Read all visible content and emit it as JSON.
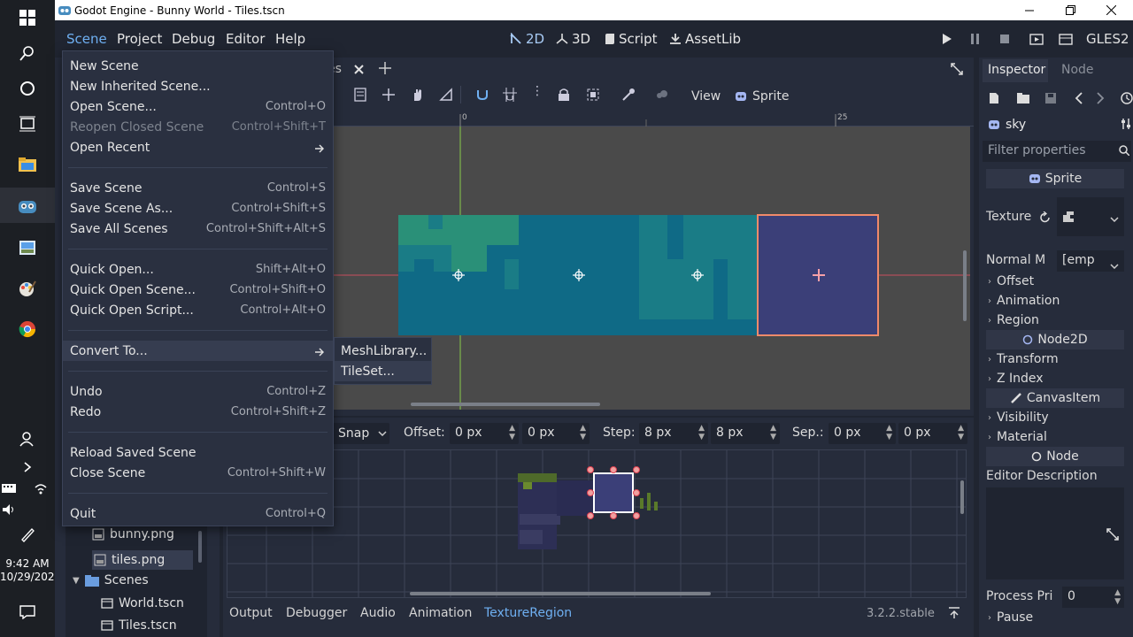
{
  "window": {
    "title": "Godot Engine - Bunny World - Tiles.tscn"
  },
  "taskbar": {
    "time": "9:42 AM",
    "date": "10/29/2020"
  },
  "menubar": {
    "menus": [
      "Scene",
      "Project",
      "Debug",
      "Editor",
      "Help"
    ],
    "workspaces": [
      "2D",
      "3D",
      "Script",
      "AssetLib"
    ],
    "renderer": "GLES2"
  },
  "scene_tab": {
    "label": "es"
  },
  "viewport_toolbar": {
    "view": "View",
    "node_type": "Sprite"
  },
  "ruler": {
    "zero": "0",
    "mark": "25"
  },
  "scene_menu": {
    "items": [
      {
        "label": "New Scene",
        "shortcut": ""
      },
      {
        "label": "New Inherited Scene...",
        "shortcut": ""
      },
      {
        "label": "Open Scene...",
        "shortcut": "Control+O"
      },
      {
        "label": "Reopen Closed Scene",
        "shortcut": "Control+Shift+T"
      },
      {
        "label": "Open Recent",
        "shortcut": ""
      },
      {
        "label": "Save Scene",
        "shortcut": "Control+S"
      },
      {
        "label": "Save Scene As...",
        "shortcut": "Control+Shift+S"
      },
      {
        "label": "Save All Scenes",
        "shortcut": "Control+Shift+Alt+S"
      },
      {
        "label": "Quick Open...",
        "shortcut": "Shift+Alt+O"
      },
      {
        "label": "Quick Open Scene...",
        "shortcut": "Control+Shift+O"
      },
      {
        "label": "Quick Open Script...",
        "shortcut": "Control+Alt+O"
      },
      {
        "label": "Convert To...",
        "shortcut": ""
      },
      {
        "label": "Undo",
        "shortcut": "Control+Z"
      },
      {
        "label": "Redo",
        "shortcut": "Control+Shift+Z"
      },
      {
        "label": "Reload Saved Scene",
        "shortcut": ""
      },
      {
        "label": "Close Scene",
        "shortcut": "Control+Shift+W"
      },
      {
        "label": "Quit",
        "shortcut": "Control+Q"
      }
    ]
  },
  "convert_submenu": {
    "items": [
      "MeshLibrary...",
      "TileSet..."
    ]
  },
  "texture_region": {
    "snap_mode": "Snap",
    "offset_label": "Offset:",
    "offset_x": "0 px",
    "offset_y": "0 px",
    "step_label": "Step:",
    "step_x": "8 px",
    "step_y": "8 px",
    "sep_label": "Sep.:",
    "sep_x": "0 px",
    "sep_y": "0 px"
  },
  "filesystem": {
    "files": [
      "bunny.png",
      "tiles.png"
    ],
    "folder": "Scenes",
    "scenes": [
      "World.tscn",
      "Tiles.tscn"
    ]
  },
  "bottom_tabs": [
    "Output",
    "Debugger",
    "Audio",
    "Animation",
    "TextureRegion"
  ],
  "version": "3.2.2.stable",
  "inspector": {
    "tabs": [
      "Inspector",
      "Node"
    ],
    "node_name": "sky",
    "filter_placeholder": "Filter properties",
    "class_header": "Sprite",
    "texture_label": "Texture",
    "normal_label": "Normal M",
    "normal_value": "[emp",
    "groups": [
      "Offset",
      "Animation",
      "Region"
    ],
    "node2d_header": "Node2D",
    "node2d_groups": [
      "Transform",
      "Z Index"
    ],
    "canvasitem_header": "CanvasItem",
    "canvasitem_groups": [
      "Visibility",
      "Material"
    ],
    "node_header": "Node",
    "editor_description": "Editor Description",
    "process_label": "Process Pri",
    "process_value": "0",
    "pause_label": "Pause"
  },
  "colors": {
    "accent": "#6fb0f2",
    "selection": "#f08a6a",
    "tile_teal": "#0f6a86",
    "tile_indigo": "#3b3f78"
  }
}
